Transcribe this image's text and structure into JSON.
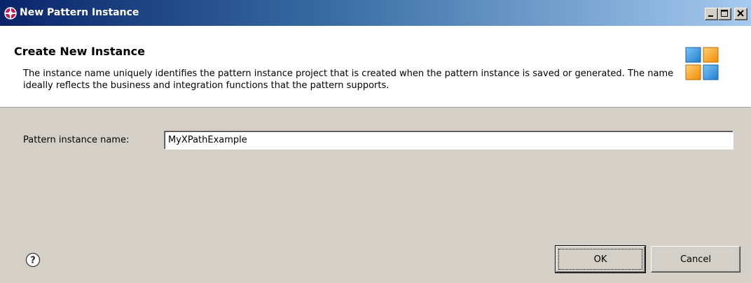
{
  "window": {
    "title": "New Pattern Instance",
    "icon": "pattern-instance-icon"
  },
  "header": {
    "title": "Create New Instance",
    "description": "The instance name uniquely identifies the pattern instance project that is created when the pattern instance is saved or generated.  The name ideally reflects the business and integration functions that the pattern supports.",
    "graphic": "wizard-banner-graphic",
    "graphic_colors": [
      "#3c9ee6",
      "#f5a623",
      "#f5a623",
      "#3c9ee6"
    ]
  },
  "form": {
    "name_label": "Pattern instance name:",
    "name_value": "MyXPathExample"
  },
  "buttons": {
    "ok_label": "OK",
    "cancel_label": "Cancel",
    "help_icon": "help-icon"
  },
  "colors": {
    "title_bar_start": "#0a246a",
    "title_bar_end": "#a6caf0",
    "dialog_bg": "#d4d0c8",
    "header_bg": "#ffffff"
  }
}
